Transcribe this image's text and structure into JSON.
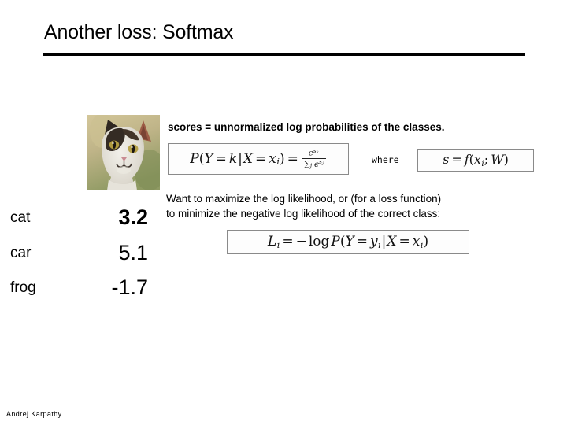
{
  "slide": {
    "title": "Another loss: Softmax",
    "footer_credit": "Andrej Karpathy"
  },
  "image": {
    "alt_name": "cat-photo",
    "subject": "cat",
    "background_color": "#c8bc92",
    "fur_light_color": "#e8e6df",
    "fur_dark_color": "#3a2f28",
    "ear_color": "#9c5b45"
  },
  "scores_table": {
    "rows": [
      {
        "label": "cat",
        "score": "3.2",
        "emphasized": true
      },
      {
        "label": "car",
        "score": "5.1",
        "emphasized": false
      },
      {
        "label": "frog",
        "score": "-1.7",
        "emphasized": false
      }
    ]
  },
  "annotations": {
    "scores_caption": "scores = unnormalized log probabilities of the classes.",
    "where_label": "where",
    "objective_line1": "Want to maximize the log likelihood, or (for a loss function)",
    "objective_line2": "to minimize the negative log likelihood of the correct class:"
  },
  "formulas": {
    "softmax": {
      "name": "softmax-probability",
      "plain": "P(Y = k|X = x_i) = e^{s_k} / sum_j e^{s_j}",
      "lhs_P": "P",
      "lhs_open": "(",
      "lhs_Y": "Y",
      "eq1": "=",
      "lhs_k": "k",
      "bar": "|",
      "lhs_X": "X",
      "eq2": "=",
      "lhs_x": "x",
      "lhs_x_sub": "i",
      "lhs_close": ")",
      "eq3": "=",
      "num_e": "e",
      "num_s": "s",
      "num_s_sub": "k",
      "den_sum": "∑",
      "den_sum_sub": "j",
      "den_e": "e",
      "den_s": "s",
      "den_s_sub": "j"
    },
    "scores_def": {
      "name": "scores-definition",
      "plain": "s = f(x_i; W)",
      "s": "s",
      "eq": "=",
      "f": "f",
      "open": "(",
      "x": "x",
      "x_sub": "i",
      "semi": ";",
      "W": "W",
      "close": ")"
    },
    "loss": {
      "name": "softmax-loss",
      "plain": "L_i = - log P(Y = y_i|X = x_i)",
      "L": "L",
      "L_sub": "i",
      "eq": "=",
      "minus": "−",
      "log": "log",
      "P": "P",
      "open": "(",
      "Y": "Y",
      "eq2": "=",
      "y": "y",
      "y_sub": "i",
      "bar": "|",
      "X": "X",
      "eq3": "=",
      "x": "x",
      "x_sub": "i",
      "close": ")"
    }
  }
}
